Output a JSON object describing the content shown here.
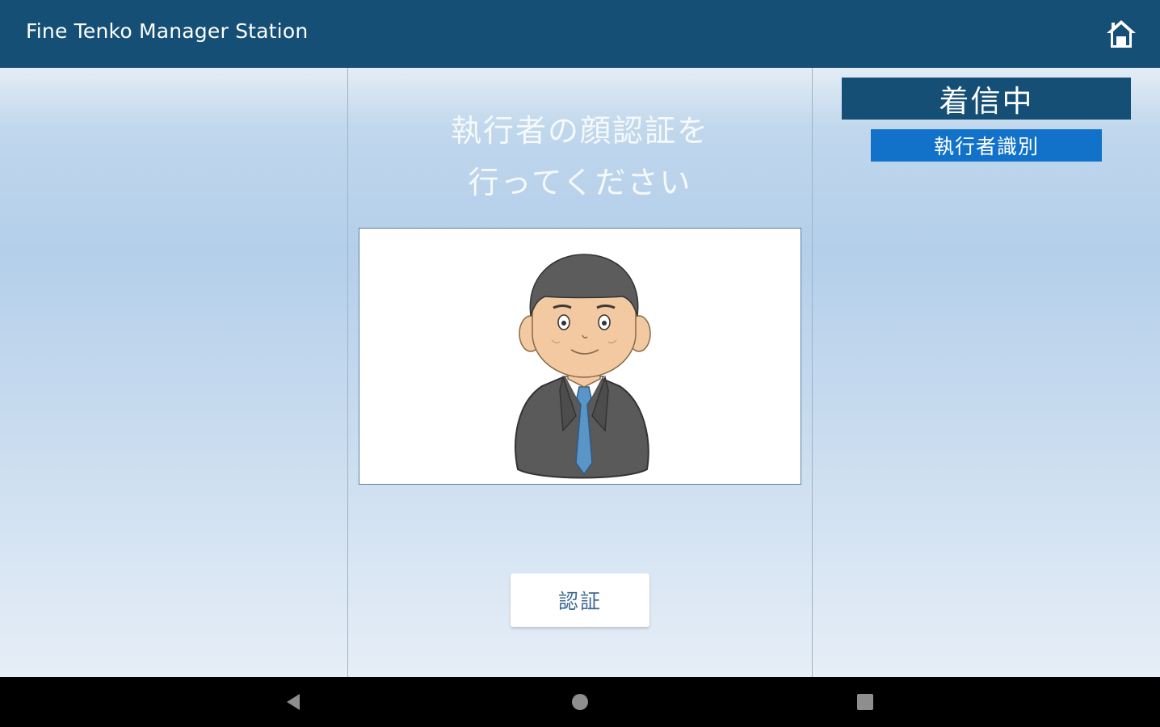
{
  "app_bar": {
    "title": "Fine Tenko Manager Station",
    "home_icon": "home-icon"
  },
  "main": {
    "prompt_line1": "執行者の顔認証を",
    "prompt_line2": "行ってください",
    "camera_preview": "face-preview-illustration",
    "auth_button_label": "認証"
  },
  "side": {
    "status_label": "着信中",
    "mode_label": "執行者識別"
  },
  "system_nav": {
    "back_icon": "back-triangle-icon",
    "home_icon": "home-circle-icon",
    "recents_icon": "recents-square-icon"
  },
  "colors": {
    "app_bar": "#164f75",
    "mode_badge": "#1272c9",
    "background_top": "#e4edf6",
    "background_mid": "#b4cfea"
  }
}
